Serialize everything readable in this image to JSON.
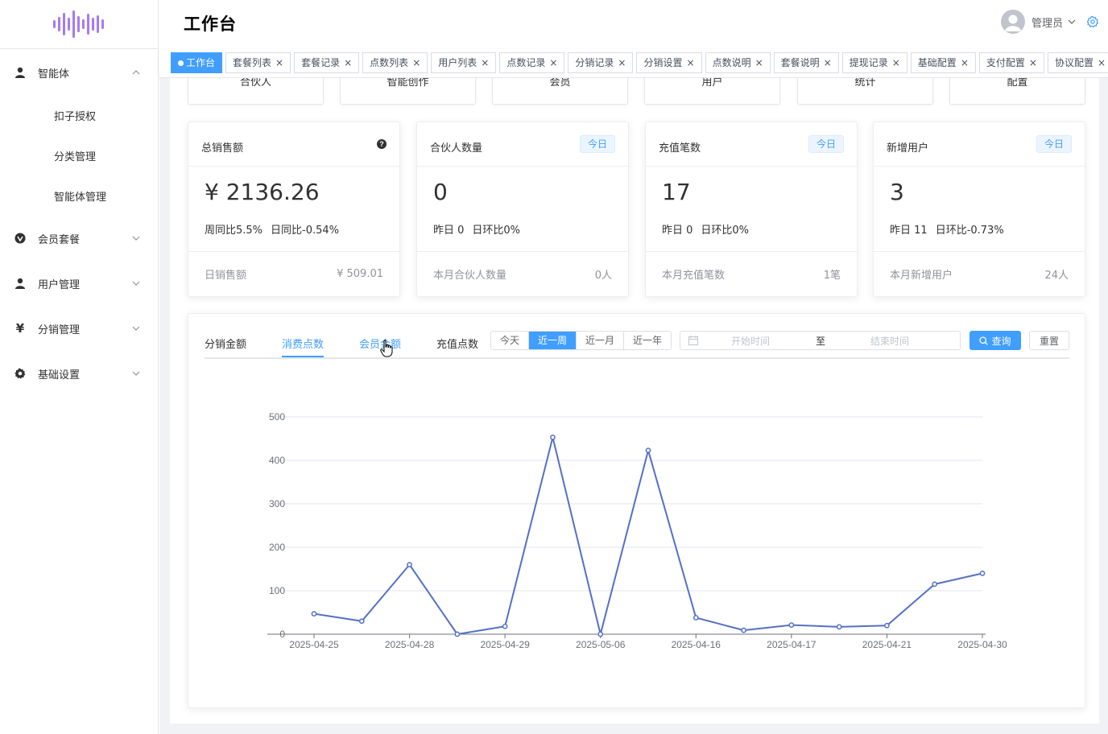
{
  "sidebar": {
    "menu": [
      {
        "label": "智能体",
        "icon": "user-icon",
        "expanded": true,
        "children": [
          "扣子授权",
          "分类管理",
          "智能体管理"
        ]
      },
      {
        "label": "会员套餐",
        "icon": "vip-badge-icon",
        "expanded": false
      },
      {
        "label": "用户管理",
        "icon": "user-icon",
        "expanded": false
      },
      {
        "label": "分销管理",
        "icon": "yen-icon",
        "expanded": false
      },
      {
        "label": "基础设置",
        "icon": "gear-icon",
        "expanded": false
      }
    ]
  },
  "header": {
    "title": "工作台",
    "user_name": "管理员"
  },
  "tags": [
    {
      "label": "工作台",
      "active": true
    },
    {
      "label": "套餐列表"
    },
    {
      "label": "套餐记录"
    },
    {
      "label": "点数列表"
    },
    {
      "label": "用户列表"
    },
    {
      "label": "点数记录"
    },
    {
      "label": "分销记录"
    },
    {
      "label": "分销设置"
    },
    {
      "label": "点数说明"
    },
    {
      "label": "套餐说明"
    },
    {
      "label": "提现记录"
    },
    {
      "label": "基础配置"
    },
    {
      "label": "支付配置"
    },
    {
      "label": "协议配置"
    }
  ],
  "quick_links": [
    "合伙人",
    "智能创作",
    "会员",
    "用户",
    "统计",
    "配置"
  ],
  "stats": [
    {
      "title": "总销售额",
      "value": "¥ 2136.26",
      "sub1": "周同比5.5%",
      "sub2": "日同比-0.54%",
      "foot_label": "日销售额",
      "foot_value": "¥ 509.01",
      "badge": "",
      "help": true
    },
    {
      "title": "合伙人数量",
      "value": "0",
      "sub1": "昨日 0",
      "sub2": "日环比0%",
      "foot_label": "本月合伙人数量",
      "foot_value": "0人",
      "badge": "今日"
    },
    {
      "title": "充值笔数",
      "value": "17",
      "sub1": "昨日 0",
      "sub2": "日环比0%",
      "foot_label": "本月充值笔数",
      "foot_value": "1笔",
      "badge": "今日"
    },
    {
      "title": "新增用户",
      "value": "3",
      "sub1": "昨日 11",
      "sub2": "日环比-0.73%",
      "foot_label": "本月新增用户",
      "foot_value": "24人",
      "badge": "今日"
    }
  ],
  "chart_panel": {
    "tabs": [
      "分销金额",
      "消费点数",
      "会员金额",
      "充值点数"
    ],
    "active_tab": "消费点数",
    "ranges": [
      "今天",
      "近一周",
      "近一月",
      "近一年"
    ],
    "active_range": "近一周",
    "start_placeholder": "开始时间",
    "range_separator": "至",
    "end_placeholder": "结束时间",
    "query_label": "查询",
    "reset_label": "重置"
  },
  "chart_data": {
    "type": "line",
    "x_tick_labels": [
      "2025-04-25",
      "2025-04-28",
      "2025-04-29",
      "2025-05-06",
      "2025-04-16",
      "2025-04-17",
      "2025-04-21",
      "2025-04-30"
    ],
    "values": [
      47,
      30,
      160,
      0,
      18,
      453,
      0,
      423,
      38,
      9,
      21,
      17,
      20,
      115,
      140
    ],
    "ylim": [
      0,
      500
    ],
    "y_ticks": [
      0,
      100,
      200,
      300,
      400,
      500
    ],
    "grid": true,
    "color": "#5470c6"
  },
  "colors": {
    "accent": "#409eff",
    "line": "#5470c6",
    "logo": "#a57bf0"
  }
}
